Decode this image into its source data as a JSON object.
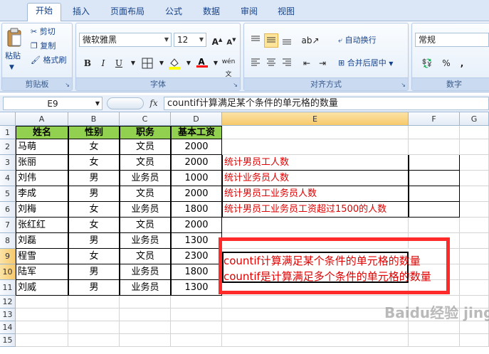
{
  "tabs": [
    "开始",
    "插入",
    "页面布局",
    "公式",
    "数据",
    "审阅",
    "视图"
  ],
  "clipboard": {
    "paste": "粘贴",
    "cut": "剪切",
    "copy": "复制",
    "format_painter": "格式刷",
    "label": "剪贴板"
  },
  "font": {
    "name": "微软雅黑",
    "size": "12",
    "bold": "B",
    "italic": "I",
    "underline": "U",
    "label": "字体"
  },
  "alignment": {
    "wrap": "自动换行",
    "merge": "合并后居中",
    "label": "对齐方式"
  },
  "number": {
    "format": "常规",
    "percent": "%",
    "comma": ",",
    "label": "数字"
  },
  "formula_bar": {
    "name_box": "E9",
    "fx": "fx",
    "content": "countif计算满足某个条件的单元格的数量"
  },
  "columns": [
    "A",
    "B",
    "C",
    "D",
    "E",
    "F",
    "G"
  ],
  "rows": [
    "1",
    "2",
    "3",
    "4",
    "5",
    "6",
    "7",
    "8",
    "9",
    "10",
    "11",
    "12",
    "13",
    "14",
    "15"
  ],
  "table": {
    "headers": [
      "姓名",
      "性别",
      "职务",
      "基本工资"
    ],
    "rows": [
      [
        "马萌",
        "女",
        "文员",
        "2000"
      ],
      [
        "张丽",
        "女",
        "文员",
        "2000"
      ],
      [
        "刘伟",
        "男",
        "业务员",
        "1000"
      ],
      [
        "李成",
        "男",
        "文员",
        "2000"
      ],
      [
        "刘梅",
        "女",
        "业务员",
        "1800"
      ],
      [
        "张红红",
        "女",
        "文员",
        "2000"
      ],
      [
        "刘磊",
        "男",
        "业务员",
        "1300"
      ],
      [
        "程雪",
        "女",
        "文员",
        "2300"
      ],
      [
        "陆军",
        "男",
        "业务员",
        "1800"
      ],
      [
        "刘威",
        "男",
        "业务员",
        "1300"
      ]
    ]
  },
  "notes": [
    "统计男员工人数",
    "统计业务员人数",
    "统计男员工业务员人数",
    "统计男员工业务员工资超过1500的人数"
  ],
  "callout": [
    "countif计算满足某个条件的单元格的数量",
    "countif是计算满足多个条件的单元格的数量"
  ],
  "watermark": "Baidu经验 jingyan.baidu.com",
  "colors": {
    "header_fill": "#92d050",
    "note_text": "#e00000",
    "callout_border": "#ff2a2a"
  }
}
